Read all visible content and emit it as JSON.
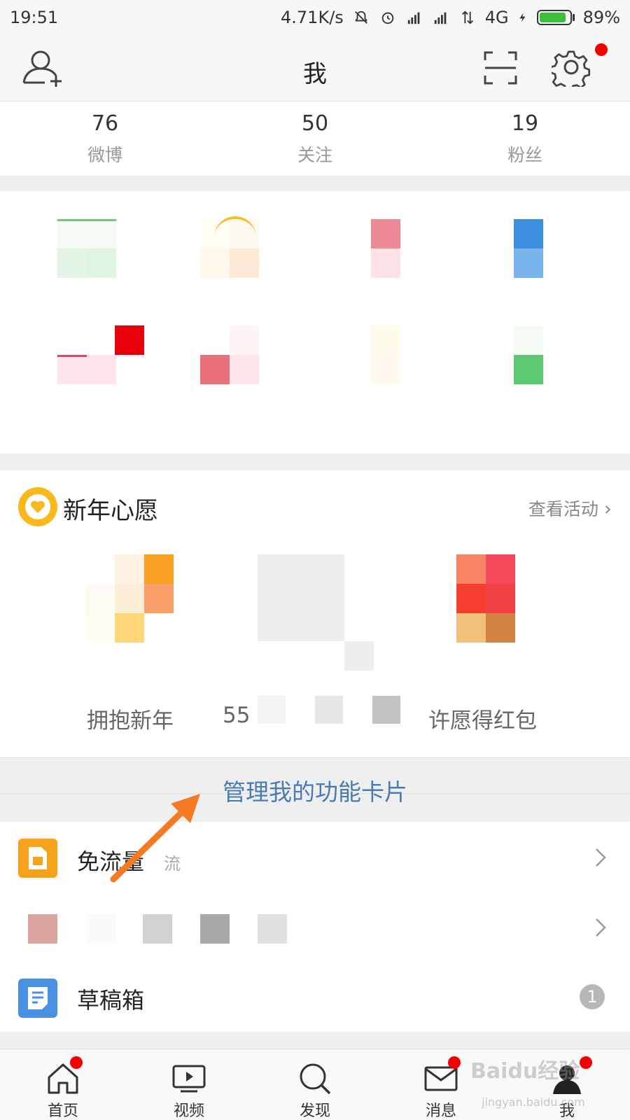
{
  "status_bar": {
    "time": "19:51",
    "network_speed": "4.71K/s",
    "network_type": "4G",
    "battery": "89%",
    "battery_level": 0.89
  },
  "header": {
    "title": "我",
    "settings_has_dot": true
  },
  "stats": [
    {
      "value": "76",
      "label": "微博"
    },
    {
      "value": "50",
      "label": "关注"
    },
    {
      "value": "19",
      "label": "粉丝"
    }
  ],
  "wish": {
    "title": "新年心愿",
    "link": "查看活动",
    "items": [
      "拥抱新年",
      "55",
      "许愿得红包"
    ]
  },
  "manage_cards": "管理我的功能卡片",
  "list": {
    "free_data": {
      "label": "免流量",
      "sub": "流"
    },
    "drafts": {
      "label": "草稿箱",
      "badge": "1"
    }
  },
  "tabs": [
    {
      "label": "首页",
      "icon": "home-icon",
      "dot": true
    },
    {
      "label": "视频",
      "icon": "video-icon",
      "dot": false
    },
    {
      "label": "发现",
      "icon": "search-icon",
      "dot": false
    },
    {
      "label": "消息",
      "icon": "mail-icon",
      "dot": true
    },
    {
      "label": "我",
      "icon": "profile-icon",
      "dot": true
    }
  ],
  "watermark": {
    "text": "Baidu经验",
    "url": "jingyan.baidu.com"
  },
  "colors": {
    "accent_blue": "#4a7bb3",
    "notify_red": "#f40000",
    "wish_yellow": "#f9b81c",
    "free_data_orange": "#f7a21b",
    "draft_blue": "#4a90e2"
  }
}
